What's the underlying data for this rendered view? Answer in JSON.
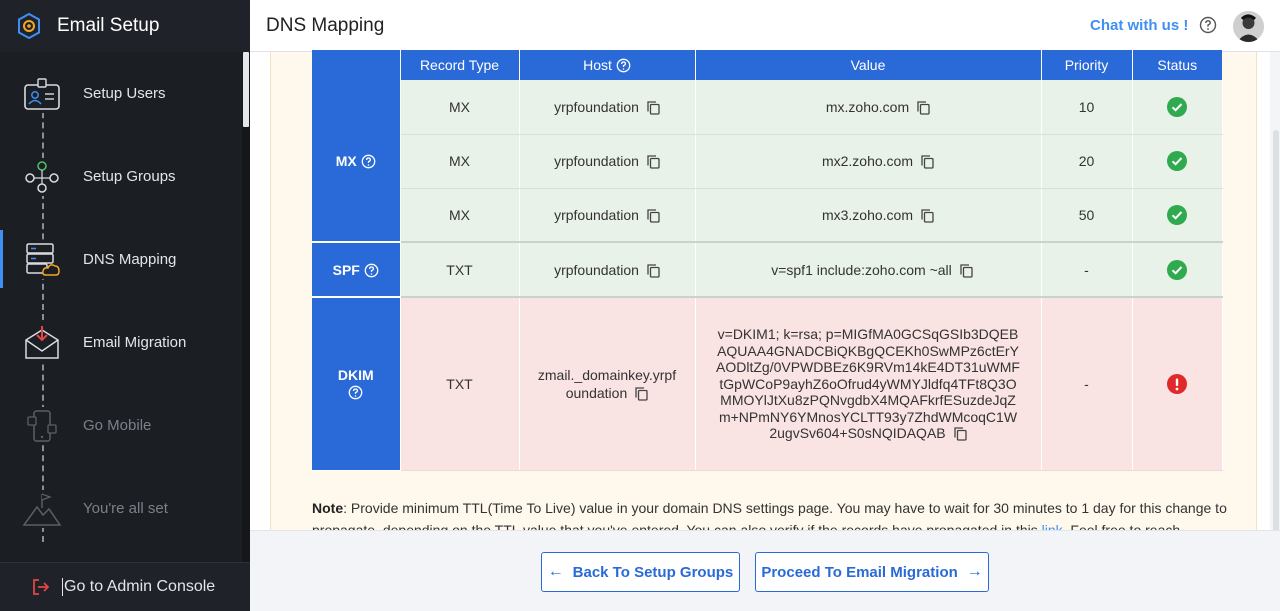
{
  "sidebar": {
    "title": "Email Setup",
    "items": [
      {
        "label": "Setup Users",
        "icon": "user-card-icon",
        "active": false,
        "enabled": true
      },
      {
        "label": "Setup Groups",
        "icon": "group-network-icon",
        "active": false,
        "enabled": true
      },
      {
        "label": "DNS Mapping",
        "icon": "server-cloud-icon",
        "active": true,
        "enabled": true
      },
      {
        "label": "Email Migration",
        "icon": "envelope-download-icon",
        "active": false,
        "enabled": true
      },
      {
        "label": "Go Mobile",
        "icon": "mobile-icon",
        "active": false,
        "enabled": false
      },
      {
        "label": "You're all set",
        "icon": "mountain-flag-icon",
        "active": false,
        "enabled": false
      }
    ],
    "footer_label": "Go to Admin Console"
  },
  "header": {
    "title": "DNS Mapping",
    "chat_label": "Chat with us !"
  },
  "table": {
    "headers": {
      "record_type": "Record Type",
      "host": "Host",
      "value": "Value",
      "priority": "Priority",
      "status": "Status"
    },
    "groups": {
      "mx": "MX",
      "spf": "SPF",
      "dkim": "DKIM"
    },
    "rows": [
      {
        "type": "MX",
        "host": "yrpfoundation",
        "value": "mx.zoho.com",
        "priority": "10",
        "status": "ok"
      },
      {
        "type": "MX",
        "host": "yrpfoundation",
        "value": "mx2.zoho.com",
        "priority": "20",
        "status": "ok"
      },
      {
        "type": "MX",
        "host": "yrpfoundation",
        "value": "mx3.zoho.com",
        "priority": "50",
        "status": "ok"
      },
      {
        "type": "TXT",
        "host": "yrpfoundation",
        "value": "v=spf1 include:zoho.com ~all",
        "priority": "-",
        "status": "ok"
      },
      {
        "type": "TXT",
        "host": "zmail._domainkey.yrpfoundation",
        "value": "v=DKIM1; k=rsa; p=MIGfMA0GCSqGSIb3DQEBAQUAA4GNADCBiQKBgQCEKh0SwMPz6ctErYAODltZg/0VPWDBEz6K9RVm14kE4DT31uWMFtGpWCoP9ayhZ6oOfrud4yWMYJldfq4TFt8Q3OMMOYlJtXu8zPQNvgdbX4MQAFkrfESuzdeJqZm+NPmNY6YMnosYCLTT93y7ZhdWMcoqC1W2ugvSv604+S0sNQIDAQAB",
        "priority": "-",
        "status": "error"
      }
    ]
  },
  "note": {
    "label": "Note",
    "text_1": ": Provide minimum TTL(Time To Live) value in your domain DNS settings page. You may have to wait for 30 minutes to 1 day for this change to propagate, depending on the TTL value that you've entered. You can also verify if the records have propagated in this ",
    "link": "link",
    "text_2": ". Feel free to reach"
  },
  "footer": {
    "back_label": "Back To Setup Groups",
    "next_label": "Proceed To Email Migration"
  },
  "colors": {
    "accent": "#2a6ad8",
    "link": "#3f8ff5",
    "success": "#2faa4f",
    "error": "#e22929",
    "sidebar_bg": "#1f2228"
  }
}
